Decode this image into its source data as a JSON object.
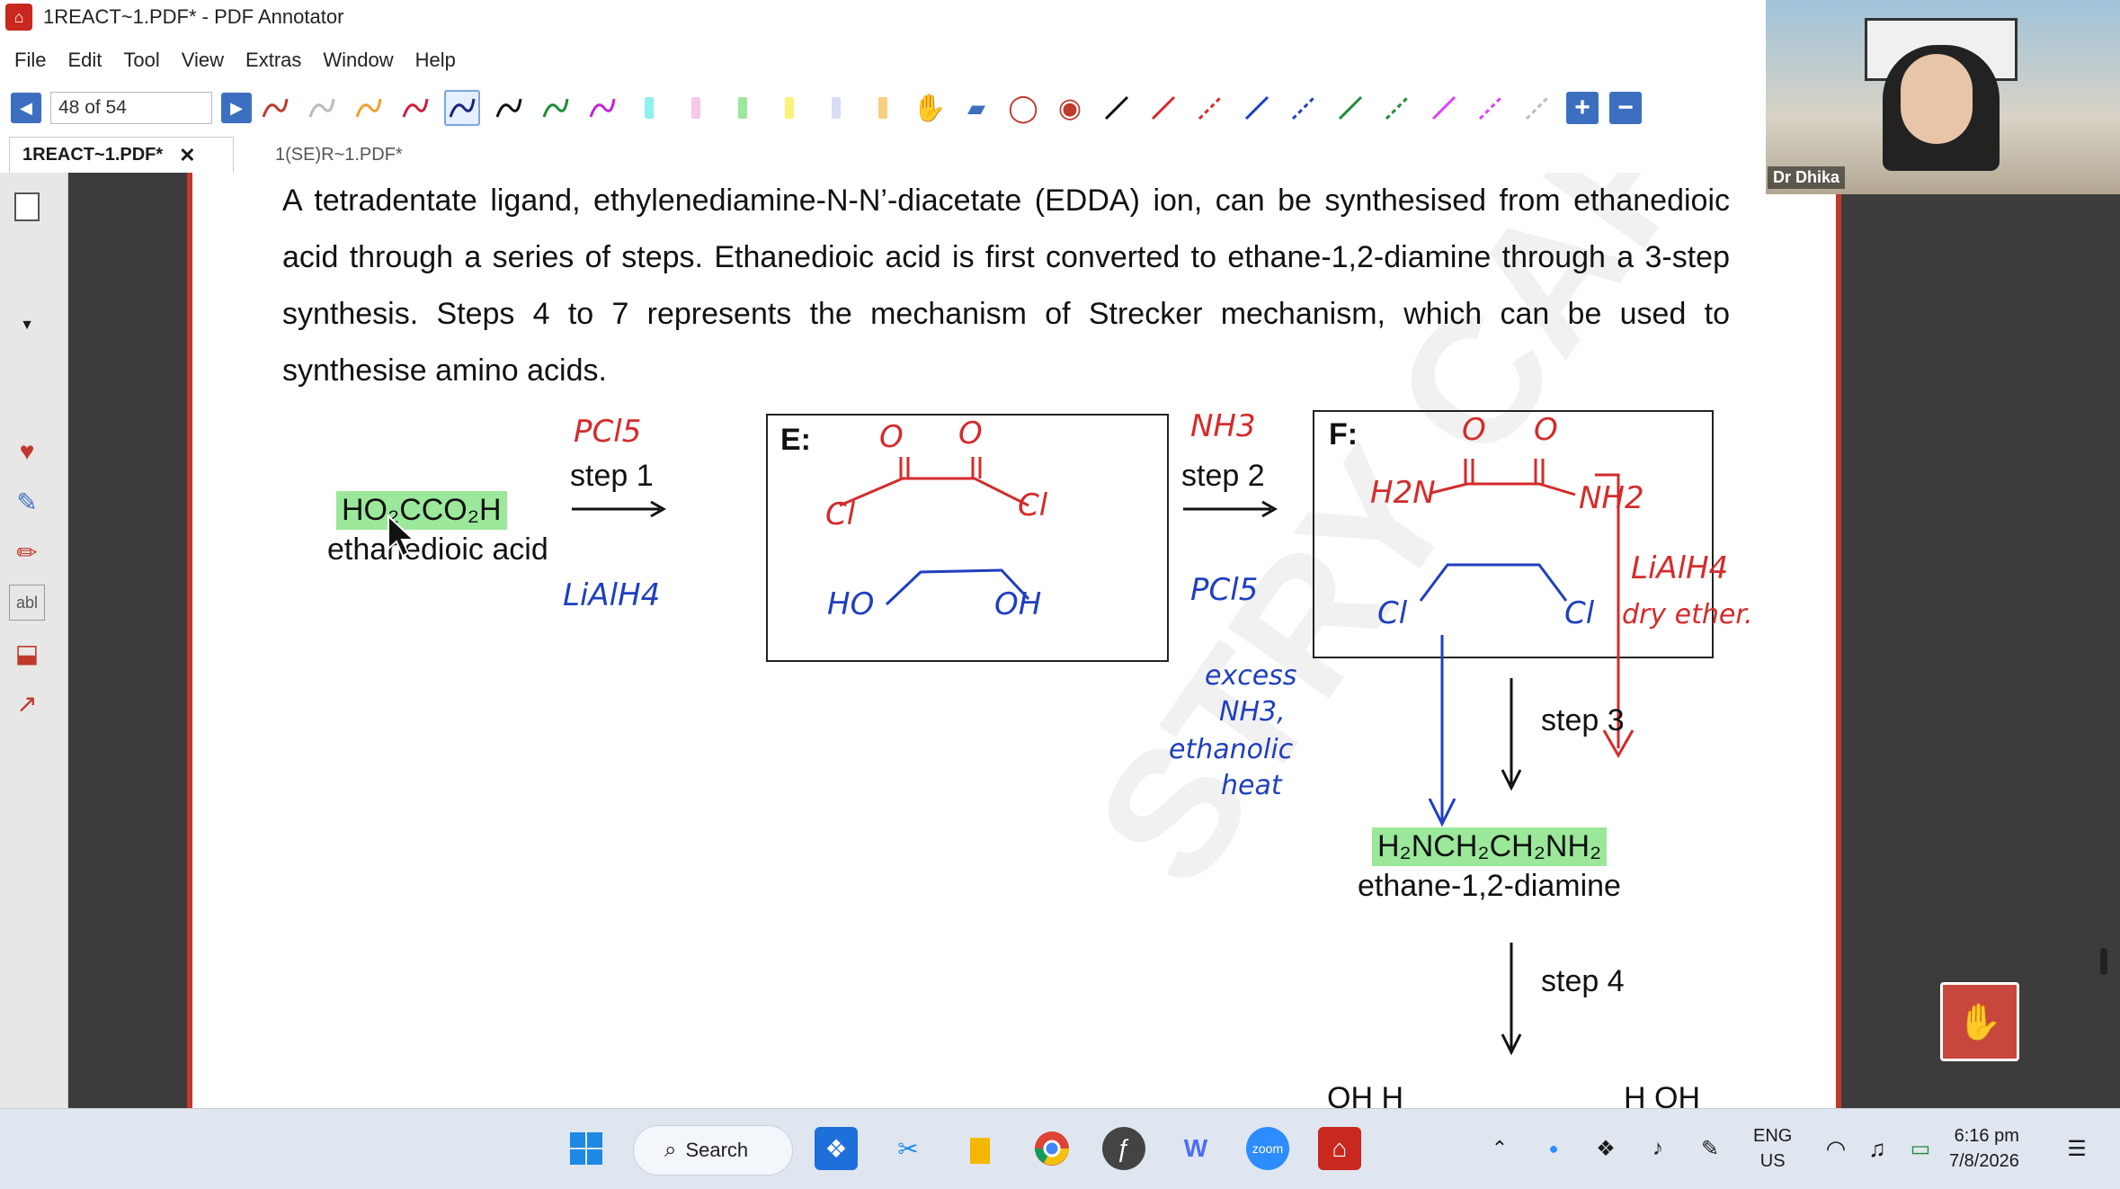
{
  "window": {
    "title": "1REACT~1.PDF* - PDF Annotator"
  },
  "menu": [
    {
      "label": "File"
    },
    {
      "label": "Edit"
    },
    {
      "label": "Tool"
    },
    {
      "label": "View"
    },
    {
      "label": "Extras"
    },
    {
      "label": "Window"
    },
    {
      "label": "Help"
    }
  ],
  "toolbar": {
    "page_value": "48 of 54"
  },
  "tabs": [
    {
      "label": "1REACT~1.PDF*",
      "close": "✕"
    },
    {
      "label": "1(SE)R~1.PDF*"
    }
  ],
  "document": {
    "paragraph": "A tetradentate ligand, ethylenediamine-N-N’-diacetate (EDDA) ion, can be synthesised from ethanedioic acid through a series of steps. Ethanedioic acid is first converted to ethane-1,2-diamine through a 3-step synthesis. Steps 4 to 7 represents the mechanism of Strecker mechanism, which can be used to synthesise amino acids.",
    "acid_formula": "HO₂CCO₂H",
    "acid_name": "ethanedioic acid",
    "step1": "step 1",
    "step2": "step 2",
    "step3": "step 3",
    "step4": "step 4",
    "box_e_label": "E:",
    "box_f_label": "F:",
    "diamine_formula": "H₂NCH₂CH₂NH₂",
    "diamine_name": "ethane-1,2-diamine",
    "bottom_partial": "OH  H",
    "bottom_partial_right": "H    OH",
    "annotations": {
      "pcl5_top": "PCl5",
      "lialh4_left": "LiAlH4",
      "nh3_top": "NH3",
      "pcl5_right": "PCl5",
      "box_e_cl_left": "Cl",
      "box_e_cl_right": "Cl",
      "box_e_o1": "O",
      "box_e_o2": "O",
      "box_e_ho": "HO",
      "box_e_oh": "OH",
      "box_f_o1": "O",
      "box_f_o2": "O",
      "box_f_h2n": "H2N",
      "box_f_nh2": "NH2",
      "box_f_cl_left": "Cl",
      "box_f_cl_right": "Cl",
      "lialh4_right": "LiAlH4",
      "dry_ether": "dry ether.",
      "excess": "excess",
      "nh3_mid": "NH3,",
      "ethanolic": "ethanolic",
      "heat": "heat"
    }
  },
  "webcam": {
    "name": "Dr Dhika"
  },
  "taskbar": {
    "search_label": "Search",
    "lang_line1": "ENG",
    "lang_line2": "US",
    "time": "6:16 pm",
    "date": "7/8/2026"
  },
  "colors": {
    "accent": "#3d6fc1",
    "annotation_red": "#d42b2b",
    "annotation_blue": "#1f3fbf",
    "highlight_green": "#9be89b",
    "page_border": "#c0392b"
  }
}
